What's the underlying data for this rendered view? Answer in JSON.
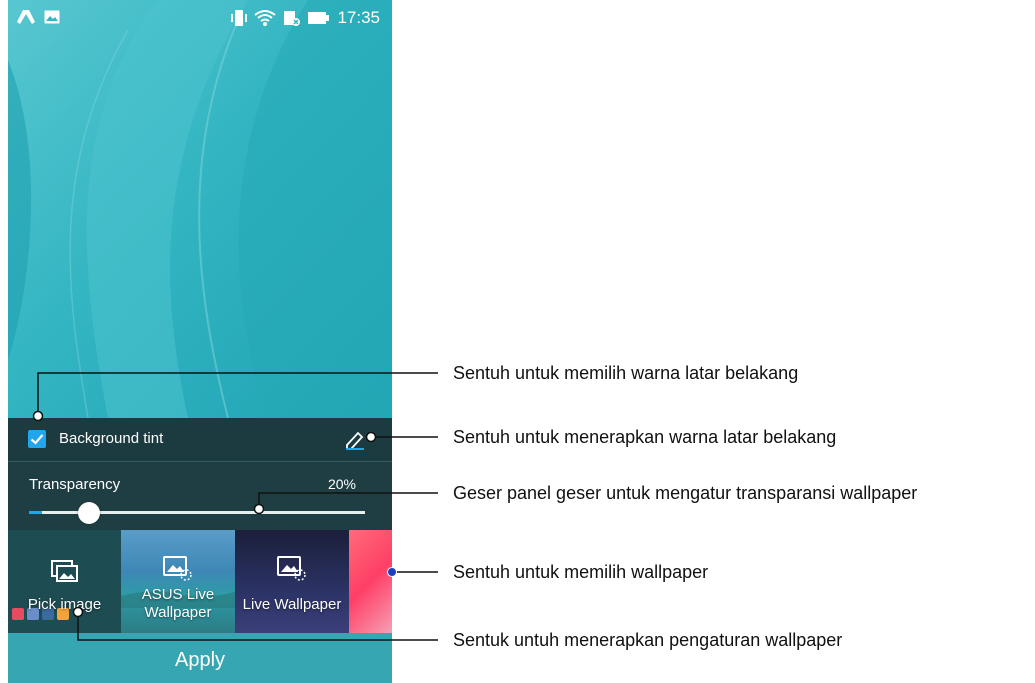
{
  "status_bar": {
    "time": "17:35",
    "left_icons": [
      "drive-icon",
      "image-icon"
    ],
    "right_icons": [
      "vibrate-icon",
      "wifi-icon",
      "data-off-icon",
      "battery-icon"
    ]
  },
  "tint": {
    "label": "Background tint",
    "checked": true
  },
  "transparency": {
    "label": "Transparency",
    "value_text": "20%",
    "value": 0.2
  },
  "wallpapers": [
    {
      "label": "Pick image",
      "icon": "gallery-icon"
    },
    {
      "label": "ASUS Live Wallpaper",
      "icon": "image-loading-icon"
    },
    {
      "label": "Live Wallpaper",
      "icon": "image-loading-icon"
    },
    {
      "label": "",
      "icon": ""
    }
  ],
  "apply_label": "Apply",
  "callouts": [
    "Sentuh untuk memilih warna latar belakang",
    "Sentuh untuk menerapkan warna latar belakang",
    "Geser panel geser untuk mengatur transparansi wallpaper",
    "Sentuh untuk memilih wallpaper",
    "Sentuk untuh menerapkan pengaturan wallpaper"
  ],
  "colors": {
    "accent": "#21a6ec",
    "wallpaper": "#2fb6c3",
    "panel": "#1f3e43",
    "apply": "#37a6b3"
  }
}
